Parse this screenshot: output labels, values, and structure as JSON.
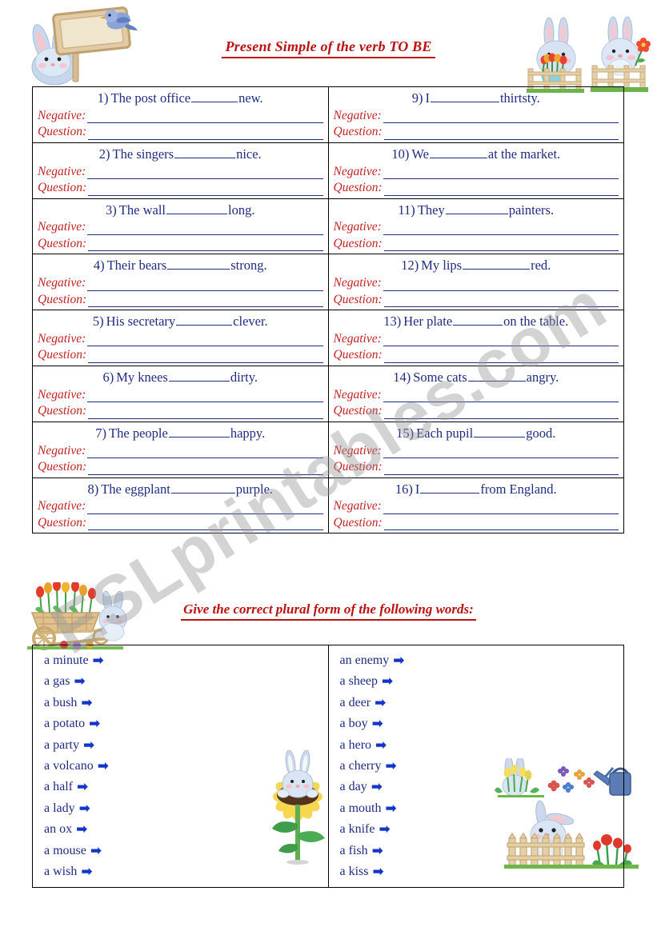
{
  "header": {
    "title": "Present Simple of the verb TO BE"
  },
  "watermark": {
    "text": "ESLprintables.com"
  },
  "decorations": [
    {
      "name": "bunny-holding-wooden-sign-with-bluebird",
      "position": "top-left"
    },
    {
      "name": "two-bunnies-on-fences-with-flowers",
      "position": "top-right"
    },
    {
      "name": "flower-cart-with-tulips-and-bunny",
      "position": "middle-left"
    },
    {
      "name": "bunny-in-sunflower",
      "position": "bottom-center"
    },
    {
      "name": "bunny-behind-picket-fence-with-watering-can-and-tulips",
      "position": "bottom-right"
    }
  ],
  "verb_exercise": {
    "negative_label": "Negative:",
    "question_label": "Question:",
    "items": [
      {
        "num": "1)",
        "before": "The post office",
        "blank": 58,
        "after": "new."
      },
      {
        "num": "2)",
        "before": "The singers",
        "blank": 76,
        "after": "nice."
      },
      {
        "num": "3)",
        "before": "The wall",
        "blank": 76,
        "after": "long."
      },
      {
        "num": "4)",
        "before": "Their bears",
        "blank": 78,
        "after": "strong."
      },
      {
        "num": "5)",
        "before": "His secretary",
        "blank": 70,
        "after": "clever."
      },
      {
        "num": "6)",
        "before": "My knees",
        "blank": 76,
        "after": "dirty."
      },
      {
        "num": "7)",
        "before": "The people",
        "blank": 76,
        "after": "happy."
      },
      {
        "num": "8)",
        "before": "The eggplant",
        "blank": 80,
        "after": "purple."
      },
      {
        "num": "9)",
        "before": "I",
        "blank": 86,
        "after": "thirtsty."
      },
      {
        "num": "10)",
        "before": "We",
        "blank": 72,
        "after": "at the market."
      },
      {
        "num": "11)",
        "before": "They",
        "blank": 78,
        "after": "painters."
      },
      {
        "num": "12)",
        "before": "My lips",
        "blank": 84,
        "after": "red."
      },
      {
        "num": "13)",
        "before": "Her plate",
        "blank": 62,
        "after": "on the table."
      },
      {
        "num": "14)",
        "before": "Some cats",
        "blank": 72,
        "after": "angry."
      },
      {
        "num": "15)",
        "before": "Each pupil",
        "blank": 64,
        "after": "good."
      },
      {
        "num": "16)",
        "before": "I",
        "blank": 74,
        "after": "from England."
      }
    ]
  },
  "plural_exercise": {
    "heading": "Give the correct plural form of the following words:",
    "arrow": "➡",
    "left_column": [
      "a minute",
      "a gas",
      "a bush",
      "a potato",
      "a party",
      "a volcano",
      "a half",
      "a lady",
      "an ox",
      "a mouse",
      "a wish"
    ],
    "right_column": [
      "an enemy",
      "a sheep",
      "a deer",
      "a boy",
      "a hero",
      "a cherry",
      "a day",
      "a mouth",
      "a knife",
      "a fish",
      "a kiss"
    ]
  },
  "colors": {
    "sentence_blue": "#1f2c80",
    "prompt_red": "#c32222",
    "heading_red": "#bb1111",
    "arrow_blue": "#1436c8"
  }
}
